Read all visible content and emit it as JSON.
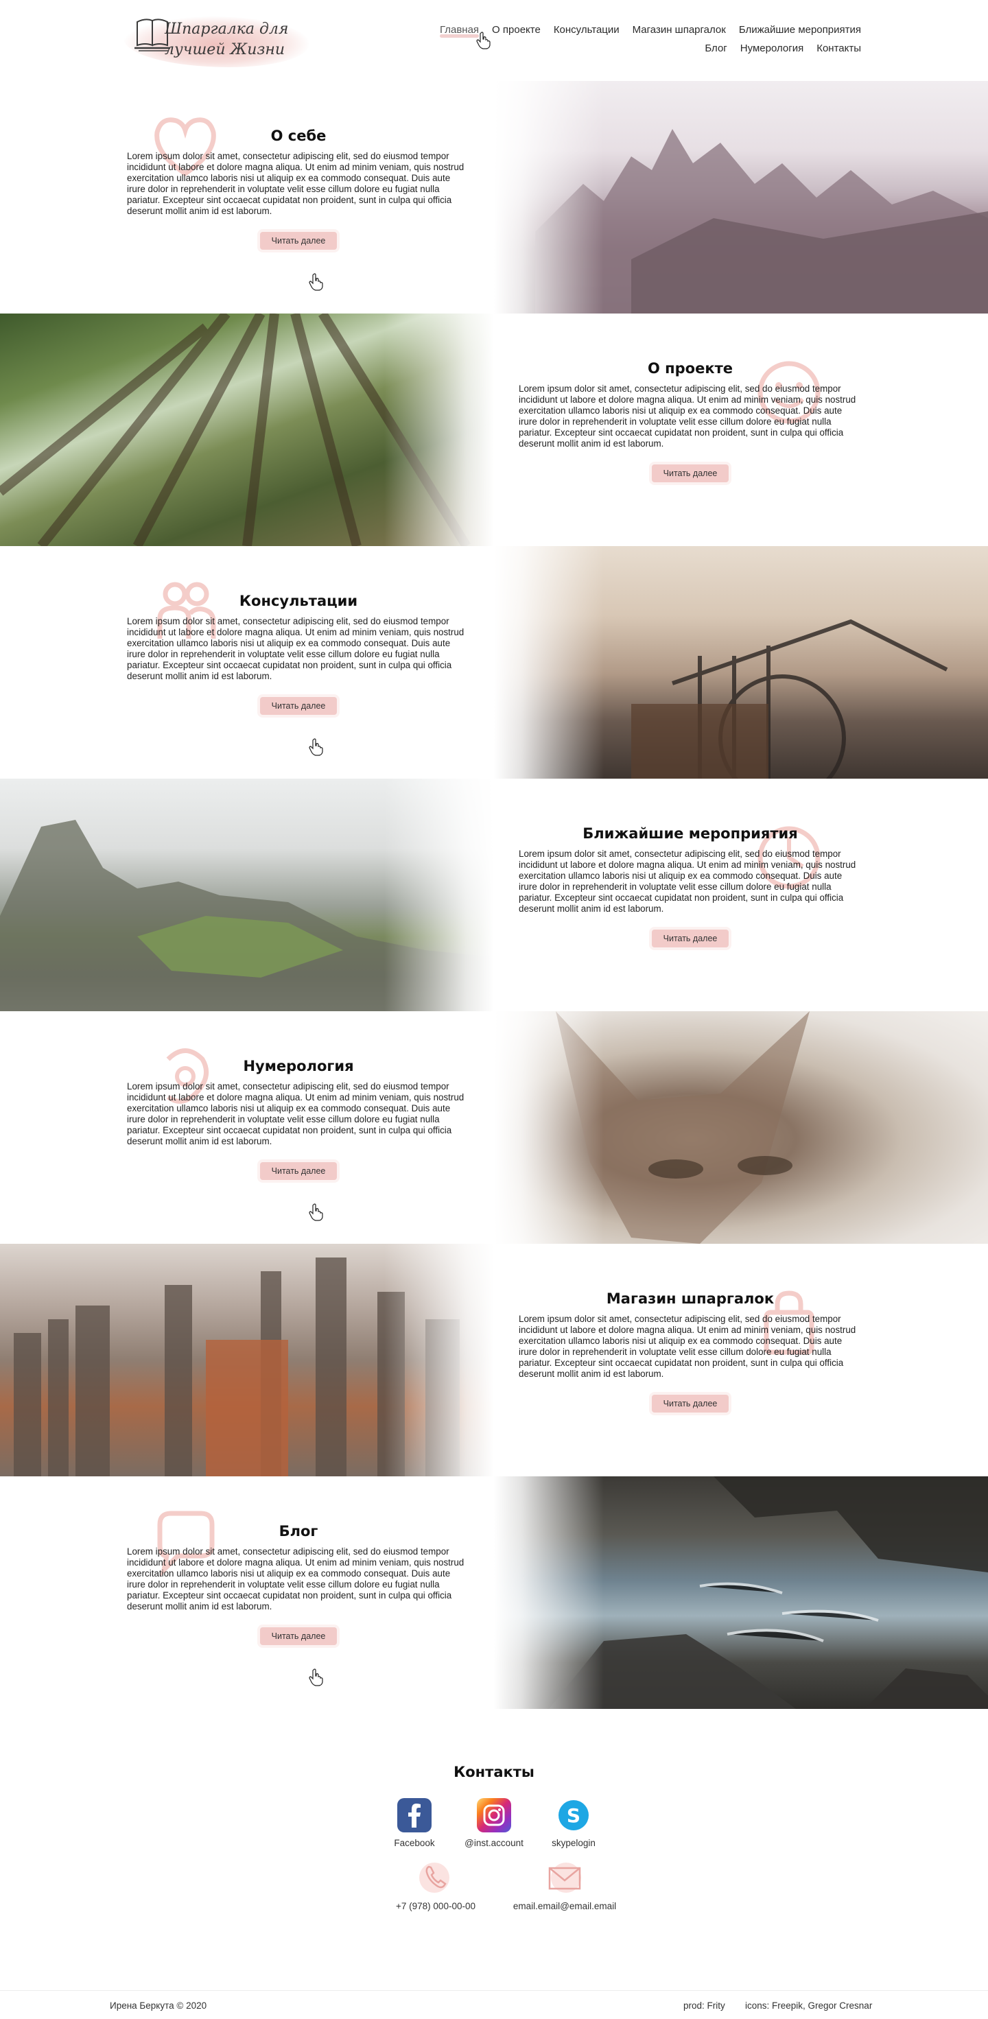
{
  "header": {
    "logo_text": "Шпаргалка для лучшей Жизни",
    "nav_row1": [
      "Главная",
      "О проекте",
      "Консультации",
      "Магазин шпаргалок",
      "Ближайшие мероприятия"
    ],
    "nav_row2": [
      "Блог",
      "Нумерология",
      "Контакты"
    ],
    "active": "Главная"
  },
  "lorem": "Lorem ipsum dolor sit amet, consectetur adipiscing elit, sed do eiusmod tempor incididunt ut labore et dolore magna aliqua. Ut enim ad minim veniam, quis nostrud exercitation ullamco laboris nisi ut aliquip ex ea commodo consequat. Duis aute irure dolor in reprehenderit in voluptate velit esse cillum dolore eu fugiat nulla pariatur. Excepteur sint occaecat cupidatat non proident, sunt in culpa qui officia deserunt mollit anim id est laborum.",
  "sections": [
    {
      "title": "О себе",
      "button": "Читать далее",
      "icon": "heart-icon",
      "image": "mountains-image"
    },
    {
      "title": "О проекте",
      "button": "Читать далее",
      "icon": "smiley-icon",
      "image": "forest-image"
    },
    {
      "title": "Консультации",
      "button": "Читать далее",
      "icon": "people-icon",
      "image": "street-bicycle-image"
    },
    {
      "title": "Ближайшие мероприятия",
      "button": "Читать далее",
      "icon": "clock-icon",
      "image": "misty-ruins-image"
    },
    {
      "title": "Нумерология",
      "button": "Читать далее",
      "icon": "numerology-icon",
      "image": "fox-image"
    },
    {
      "title": "Магазин шпаргалок",
      "button": "Читать далее",
      "icon": "shopping-bag-icon",
      "image": "city-skyline-image"
    },
    {
      "title": "Блог",
      "button": "Читать далее",
      "icon": "speech-bubble-icon",
      "image": "sea-cliffs-image"
    }
  ],
  "contacts": {
    "title": "Контакты",
    "facebook": "Facebook",
    "instagram": "@inst.account",
    "skype": "skypelogin",
    "phone": "+7 (978) 000-00-00",
    "email": "email.email@email.email"
  },
  "footer": {
    "copyright": "Ирена Беркута © 2020",
    "prod": "prod: Frity",
    "icons": "icons: Freepik, Gregor Cresnar"
  },
  "colors": {
    "accent_pink": "#f2cbc9",
    "facebook_blue": "#3b5998",
    "skype_blue": "#1ea7e4"
  }
}
